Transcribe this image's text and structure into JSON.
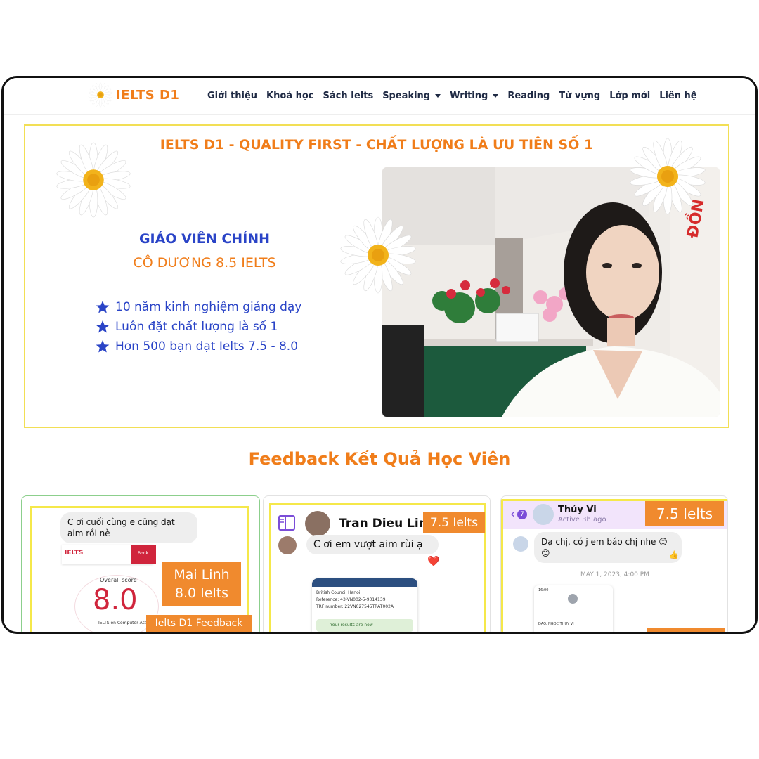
{
  "brand": {
    "name": "IELTS D1"
  },
  "nav": {
    "items": [
      {
        "label": "Giới thiệu",
        "dropdown": false
      },
      {
        "label": "Khoá học",
        "dropdown": false
      },
      {
        "label": "Sách Ielts",
        "dropdown": false
      },
      {
        "label": "Speaking",
        "dropdown": true
      },
      {
        "label": "Writing",
        "dropdown": true
      },
      {
        "label": "Reading",
        "dropdown": false
      },
      {
        "label": "Từ vựng",
        "dropdown": false
      },
      {
        "label": "Lớp mới",
        "dropdown": false
      },
      {
        "label": "Liên hệ",
        "dropdown": false
      }
    ]
  },
  "hero": {
    "title": "IELTS D1 - QUALITY FIRST - CHẤT LƯỢNG LÀ ƯU TIÊN SỐ 1",
    "teacher_role": "GIÁO VIÊN CHÍNH",
    "teacher_name": "CÔ DƯƠNG 8.5 IELTS",
    "bullets": [
      "10 năm kinh nghiệm giảng dạy",
      "Luôn đặt chất lượng là số 1",
      "Hơn 500 bạn đạt Ielts 7.5 - 8.0"
    ]
  },
  "feedback": {
    "title": "Feedback Kết Quả Học Viên",
    "cards": [
      {
        "message": "C ơi cuối cùng e cũng đạt aim rồi nè",
        "app_logo": "IELTS",
        "app_button": "Book",
        "score_label": "Overall score",
        "score": "8.0",
        "score_caption": "IELTS on Computer Academic",
        "student_name": "Mai Linh",
        "student_score": "8.0 Ielts",
        "footer_tag": "Ielts D1 Feedback"
      },
      {
        "sender": "Tran Dieu Linh",
        "score_tag": "7.5 Ielts",
        "message": "C ơi em vượt aim rùi ạ",
        "reaction": "❤️",
        "doc_org": "British Council Hanoi",
        "doc_ref": "Reference: 43-VN002-5-9014139",
        "doc_trf": "TRF number: 22VN027545TRAT002A",
        "doc_status": "Your results are now"
      },
      {
        "sender": "Thúy Vi",
        "status": "Active 3h ago",
        "back_count": "7",
        "score_tag": "7.5 Ielts",
        "message": "Dạ chị, có j em báo chị nhe 😊😊",
        "reaction": "👍",
        "timestamp": "MAY 1, 2023, 4:00 PM",
        "phone_time": "16:00",
        "phone_name": "DAO. NGOC THUY VI"
      }
    ]
  },
  "colors": {
    "orange": "#f07d1a",
    "blue": "#2a44c7",
    "yellow_border": "#f2df55",
    "purple": "#7b4dd8"
  }
}
